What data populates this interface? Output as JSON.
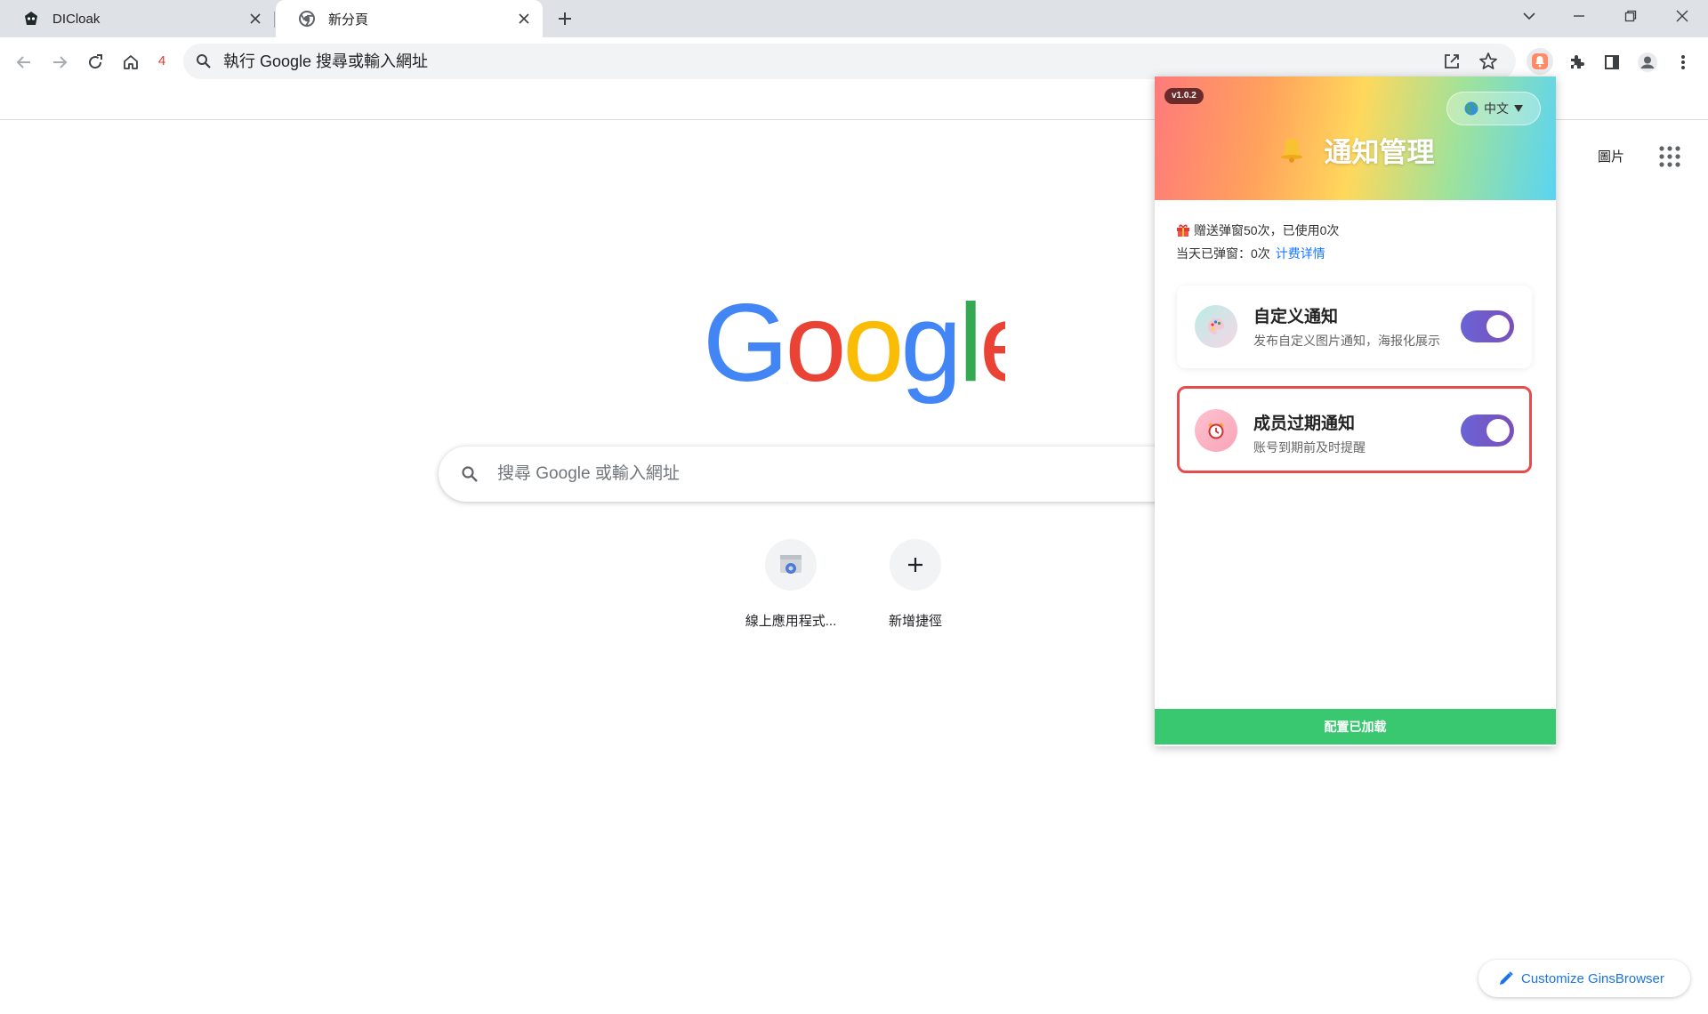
{
  "tabs": [
    {
      "title": "DICloak"
    },
    {
      "title": "新分頁"
    }
  ],
  "toolbar": {
    "tab_count": "4",
    "omnibox_placeholder": "執行 Google 搜尋或輸入網址"
  },
  "ntp": {
    "search_placeholder": "搜尋 Google 或輸入網址",
    "images_link": "圖片",
    "shortcuts": [
      {
        "label": "線上應用程式..."
      },
      {
        "label": "新增捷徑"
      }
    ],
    "customize_label": "Customize GinsBrowser"
  },
  "popup": {
    "version": "v1.0.2",
    "language": "中文",
    "title": "通知管理",
    "gift_info": "赠送弹窗50次，已使用0次",
    "today_info": "当天已弹窗：0次",
    "billing_link": "计费详情",
    "cards": [
      {
        "title": "自定义通知",
        "desc": "发布自定义图片通知，海报化展示",
        "enabled": true
      },
      {
        "title": "成员过期通知",
        "desc": "账号到期前及时提醒",
        "enabled": true
      }
    ],
    "footer": "配置已加载"
  },
  "colors": {
    "accent_blue": "#1a73e8",
    "toggle_purple": "#6a63d6",
    "footer_green": "#39c870",
    "highlight_red": "#e84b4b"
  }
}
